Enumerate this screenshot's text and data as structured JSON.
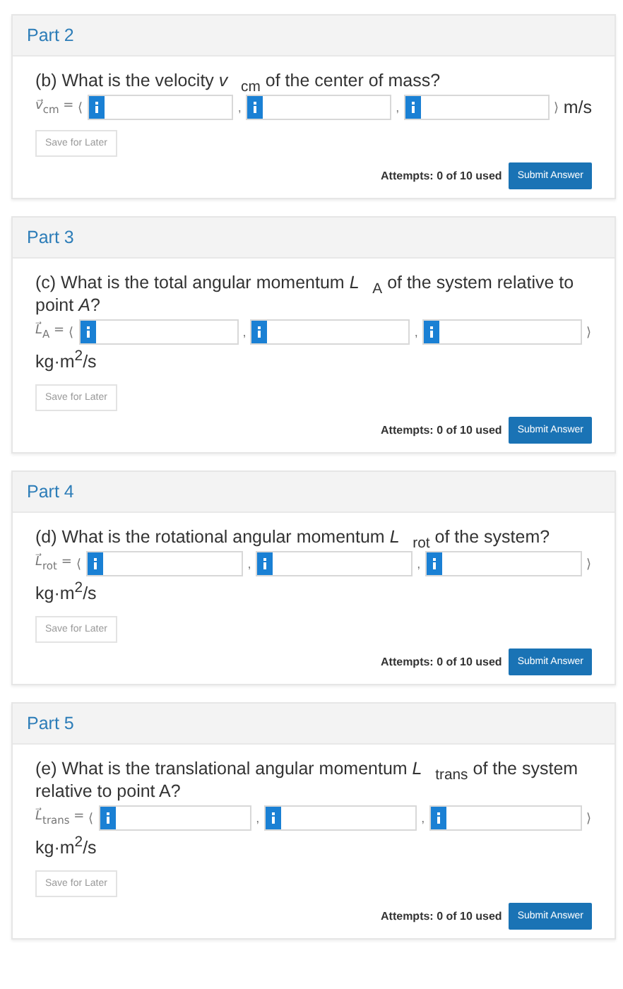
{
  "parts": [
    {
      "title": "Part 2",
      "question": "(b) What is the velocity *v⃗*$_{cm}$ of the center of mass?",
      "symbol": "*v⃗*$_{cm}$ =",
      "open": "⟨",
      "inputs": [
        {
          "separator": ","
        },
        {
          "separator": ","
        },
        {
          "separator": "⟩"
        }
      ],
      "unit": "m/s",
      "unit_below": false,
      "save_label": "Save for Later",
      "attempts": "Attempts: 0 of 10 used",
      "submit_label": "Submit Answer"
    },
    {
      "title": "Part 3",
      "question": "(c) What is the total angular momentum *L⃗*$_{A}$ of the system relative to point *A*?",
      "symbol": "*L⃗*$_{A}$ =",
      "open": "⟨",
      "inputs": [
        {
          "separator": ","
        },
        {
          "separator": ","
        },
        {
          "separator": "⟩"
        }
      ],
      "unit": "kg·m$^{2}$/s",
      "unit_below": true,
      "save_label": "Save for Later",
      "attempts": "Attempts: 0 of 10 used",
      "submit_label": "Submit Answer"
    },
    {
      "title": "Part 4",
      "question": "(d) What is the rotational angular momentum *L⃗*$_{rot}$ of the system?",
      "symbol": "*L⃗*$_{rot}$ =",
      "open": "⟨",
      "inputs": [
        {
          "separator": ","
        },
        {
          "separator": ","
        },
        {
          "separator": "⟩"
        }
      ],
      "unit": "kg·m$^{2}$/s",
      "unit_below": true,
      "save_label": "Save for Later",
      "attempts": "Attempts: 0 of 10 used",
      "submit_label": "Submit Answer"
    },
    {
      "title": "Part 5",
      "question": "(e) What is the translational angular momentum *L⃗*$_{trans}$ of the system relative to point A?",
      "symbol": "*L⃗*$_{trans}$ =",
      "open": "⟨",
      "inputs": [
        {
          "separator": ","
        },
        {
          "separator": ","
        },
        {
          "separator": "⟩"
        }
      ],
      "unit": "kg·m$^{2}$/s",
      "unit_below": true,
      "save_label": "Save for Later",
      "attempts": "Attempts: 0 of 10 used",
      "submit_label": "Submit Answer"
    }
  ]
}
